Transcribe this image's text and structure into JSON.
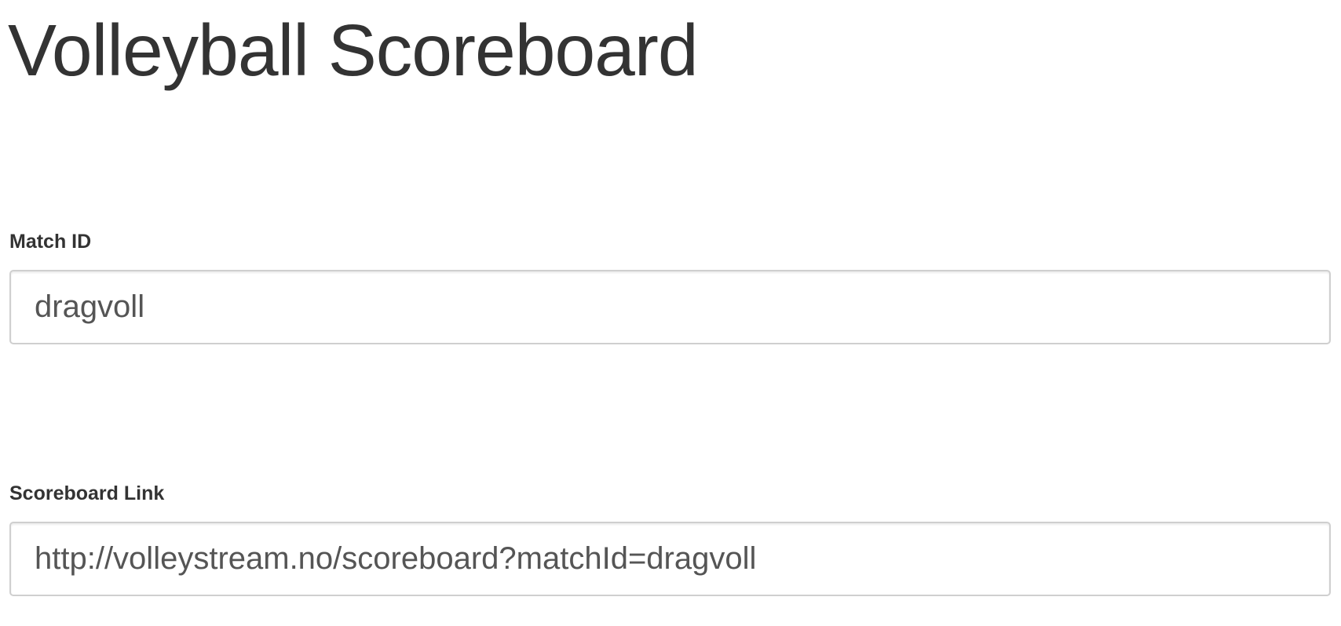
{
  "page": {
    "title": "Volleyball Scoreboard"
  },
  "form": {
    "match_id": {
      "label": "Match ID",
      "value": "dragvoll"
    },
    "scoreboard_link": {
      "label": "Scoreboard Link",
      "value": "http://volleystream.no/scoreboard?matchId=dragvoll"
    }
  }
}
